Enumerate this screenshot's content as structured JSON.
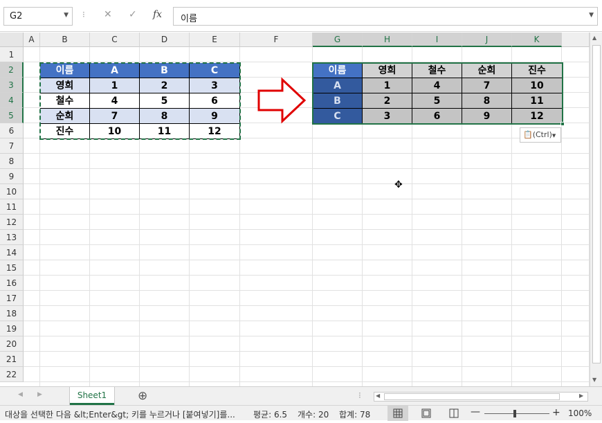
{
  "formula_bar": {
    "name_box": "G2",
    "cancel_icon": "✕",
    "enter_icon": "✓",
    "fx_label": "fx",
    "formula": "이름"
  },
  "columns": [
    "A",
    "B",
    "C",
    "D",
    "E",
    "F",
    "G",
    "H",
    "I",
    "J",
    "K"
  ],
  "rows": [
    "1",
    "2",
    "3",
    "4",
    "5",
    "6",
    "7",
    "8",
    "9",
    "10",
    "11",
    "12",
    "13",
    "14",
    "15",
    "16",
    "17",
    "18",
    "19",
    "20",
    "21",
    "22"
  ],
  "source_table": {
    "header": [
      "이름",
      "A",
      "B",
      "C"
    ],
    "rows": [
      [
        "영희",
        "1",
        "2",
        "3"
      ],
      [
        "철수",
        "4",
        "5",
        "6"
      ],
      [
        "순희",
        "7",
        "8",
        "9"
      ],
      [
        "진수",
        "10",
        "11",
        "12"
      ]
    ]
  },
  "transposed_table": {
    "header": [
      "이름",
      "영희",
      "철수",
      "순희",
      "진수"
    ],
    "rows": [
      [
        "A",
        "1",
        "4",
        "7",
        "10"
      ],
      [
        "B",
        "2",
        "5",
        "8",
        "11"
      ],
      [
        "C",
        "3",
        "6",
        "9",
        "12"
      ]
    ]
  },
  "paste_options": {
    "label": "(Ctrl)"
  },
  "sheet_tabs": {
    "active": "Sheet1",
    "add_icon": "⊕"
  },
  "status_bar": {
    "message": "대상을 선택한 다음 &lt;Enter&gt; 키를 누르거나 [붙여넣기]를...",
    "average": "평균: 6.5",
    "count": "개수: 20",
    "sum": "합계: 78",
    "zoom": "100%"
  },
  "colors": {
    "accent": "#217346",
    "header_blue": "#4472c4",
    "arrow_red": "#e00000"
  }
}
